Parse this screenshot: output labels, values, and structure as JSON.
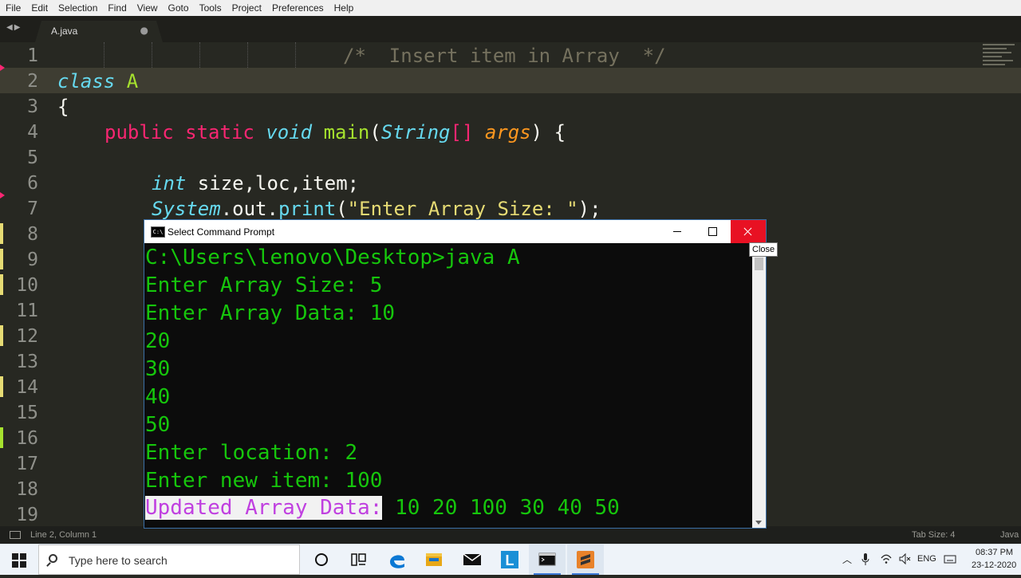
{
  "menu": [
    "File",
    "Edit",
    "Selection",
    "Find",
    "View",
    "Goto",
    "Tools",
    "Project",
    "Preferences",
    "Help"
  ],
  "tab": {
    "label": "A.java",
    "dirty_indicator": "●"
  },
  "editor": {
    "line_numbers": [
      "1",
      "2",
      "3",
      "4",
      "5",
      "6",
      "7",
      "8",
      "9",
      "10",
      "11",
      "12",
      "13",
      "14",
      "15",
      "16",
      "17",
      "18",
      "19"
    ],
    "line1_comment": "/*  Insert item in Array  */",
    "line2": {
      "kw": "class",
      "name": "A"
    },
    "line3": "{",
    "line4": {
      "public": "public",
      "static": "static",
      "void": "void",
      "main": "main",
      "open": "(",
      "type": "String",
      "brackets": "[]",
      "param": "args",
      "close": ") {"
    },
    "line6": {
      "type": "int",
      "rest": " size,loc,item;"
    },
    "line7": {
      "sys": "System",
      "dot1": ".",
      "out": "out",
      "dot2": ".",
      "print": "print",
      "open": "(",
      "str": "\"Enter Array Size: \"",
      "close": ");"
    }
  },
  "status": {
    "position": "Line 2, Column 1",
    "tab_size": "Tab Size: 4",
    "syntax": "Java"
  },
  "cmd": {
    "title": "Select Command Prompt",
    "icon_text": "C:\\",
    "tooltip": "Close",
    "lines": [
      "C:\\Users\\lenovo\\Desktop>java A",
      "Enter Array Size: 5",
      "Enter Array Data: 10",
      "20",
      "30",
      "40",
      "50",
      "Enter location: 2",
      "Enter new item: 100"
    ],
    "result_label": "Updated Array Data:",
    "result_values": " 10 20 100 30 40 50"
  },
  "taskbar": {
    "search_placeholder": "Type here to search",
    "apps": [
      "cortana-icon",
      "task-view-icon",
      "edge-icon",
      "file-explorer-icon",
      "mail-icon",
      "lens-app-icon",
      "command-prompt-icon",
      "sublime-text-icon"
    ],
    "lens_letter": "L",
    "language": "ENG",
    "time": "08:37 PM",
    "date": "23-12-2020"
  },
  "colors": {
    "editor_bg": "#272822",
    "keyword": "#66d9ef",
    "storage": "#f92672",
    "function": "#a6e22e",
    "param": "#fd971f",
    "string": "#e6db74",
    "console_text": "#16c60c",
    "highlight_text": "#c040e0"
  }
}
